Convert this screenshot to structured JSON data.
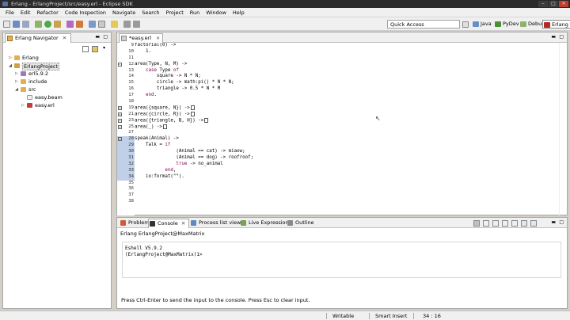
{
  "window": {
    "title": "Erlang - ErlangProject/src/easy.erl - Eclipse SDK"
  },
  "menu": [
    "File",
    "Edit",
    "Refactor",
    "Code Inspection",
    "Navigate",
    "Search",
    "Project",
    "Run",
    "Window",
    "Help"
  ],
  "toolbar": {
    "quick_access_placeholder": "Quick Access",
    "perspectives": [
      "Java",
      "PyDev",
      "Debug",
      "Erlang"
    ]
  },
  "navigator": {
    "title": "Erlang Navigator",
    "items": [
      {
        "label": "Erlang"
      },
      {
        "label": "ErlangProject"
      },
      {
        "label": "erl5.9.2"
      },
      {
        "label": "include"
      },
      {
        "label": "src"
      },
      {
        "label": "easy.beam"
      },
      {
        "label": "easy.erl"
      }
    ]
  },
  "editor": {
    "tab_label": "*easy.erl",
    "lines": [
      {
        "n": "9",
        "code": "factorial(0) ->"
      },
      {
        "n": "10",
        "code": "    1."
      },
      {
        "n": "11",
        "code": ""
      },
      {
        "n": "12",
        "code": "area(Type, N, M) ->"
      },
      {
        "n": "13",
        "code": "    case Type of"
      },
      {
        "n": "14",
        "code": "        square -> N * N;"
      },
      {
        "n": "15",
        "code": "        circle -> math:pi() * N * N;"
      },
      {
        "n": "16",
        "code": "        triangle -> 0.5 * N * M"
      },
      {
        "n": "17",
        "code": "    end."
      },
      {
        "n": "18",
        "code": ""
      },
      {
        "n": "19",
        "code": "area({square, N}) ->"
      },
      {
        "n": "21",
        "code": "area({circle, R}) ->"
      },
      {
        "n": "23",
        "code": "area({triangle, B, H}) ->"
      },
      {
        "n": "25",
        "code": "area(_) ->"
      },
      {
        "n": "27",
        "code": ""
      },
      {
        "n": "28",
        "code": "speak(Animal) ->"
      },
      {
        "n": "29",
        "code": "    Talk = if"
      },
      {
        "n": "30",
        "code": "               (Animal == cat) -> miaow;"
      },
      {
        "n": "31",
        "code": "               (Animal == dog) -> roofroof;"
      },
      {
        "n": "32",
        "code": "               true -> no_animal"
      },
      {
        "n": "33",
        "code": "           end,"
      },
      {
        "n": "34",
        "code": "    io:format(\"\")."
      },
      {
        "n": "35",
        "code": ""
      },
      {
        "n": "36",
        "code": ""
      },
      {
        "n": "37",
        "code": ""
      },
      {
        "n": "38",
        "code": ""
      }
    ]
  },
  "console": {
    "tabs": [
      "Problems",
      "Console",
      "Process list view",
      "Live Expressions",
      "Outline"
    ],
    "title": "Erlang ErlangProject@MaxMatrix",
    "output": [
      "Eshell V5.9.2",
      "(ErlangProject@MaxMatrix)1>"
    ],
    "hint": "Press Ctrl-Enter to send the input to the console. Press Esc to clear input."
  },
  "status": {
    "mode": "Writable",
    "insert": "Smart Insert",
    "position": "34 : 16"
  }
}
